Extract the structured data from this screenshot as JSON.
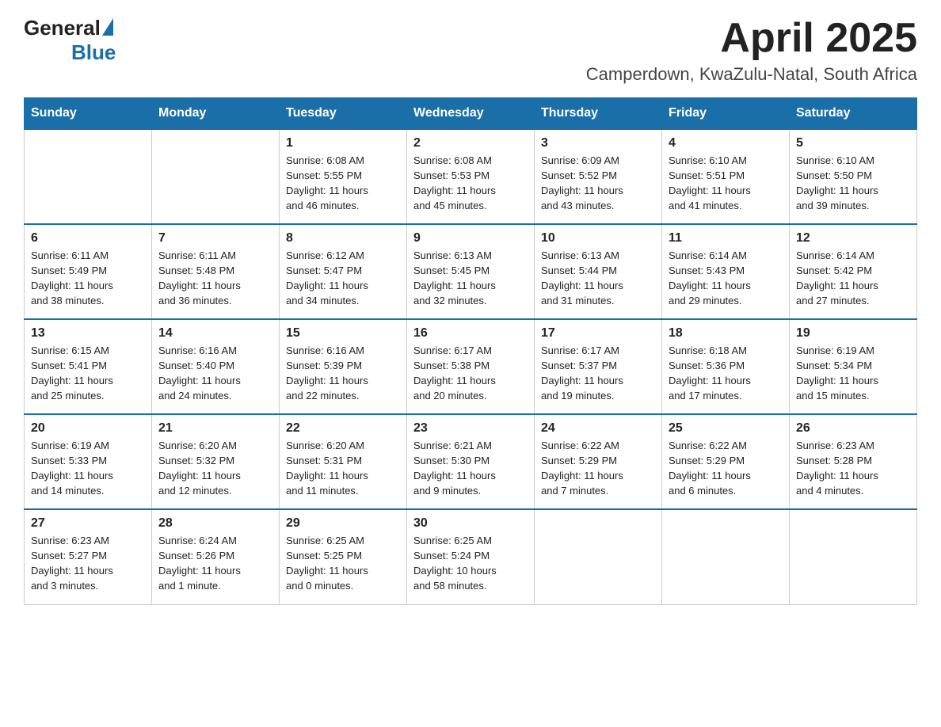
{
  "header": {
    "logo_general": "General",
    "logo_blue": "Blue",
    "month_title": "April 2025",
    "location": "Camperdown, KwaZulu-Natal, South Africa"
  },
  "weekdays": [
    "Sunday",
    "Monday",
    "Tuesday",
    "Wednesday",
    "Thursday",
    "Friday",
    "Saturday"
  ],
  "weeks": [
    [
      {
        "day": "",
        "info": ""
      },
      {
        "day": "",
        "info": ""
      },
      {
        "day": "1",
        "info": "Sunrise: 6:08 AM\nSunset: 5:55 PM\nDaylight: 11 hours\nand 46 minutes."
      },
      {
        "day": "2",
        "info": "Sunrise: 6:08 AM\nSunset: 5:53 PM\nDaylight: 11 hours\nand 45 minutes."
      },
      {
        "day": "3",
        "info": "Sunrise: 6:09 AM\nSunset: 5:52 PM\nDaylight: 11 hours\nand 43 minutes."
      },
      {
        "day": "4",
        "info": "Sunrise: 6:10 AM\nSunset: 5:51 PM\nDaylight: 11 hours\nand 41 minutes."
      },
      {
        "day": "5",
        "info": "Sunrise: 6:10 AM\nSunset: 5:50 PM\nDaylight: 11 hours\nand 39 minutes."
      }
    ],
    [
      {
        "day": "6",
        "info": "Sunrise: 6:11 AM\nSunset: 5:49 PM\nDaylight: 11 hours\nand 38 minutes."
      },
      {
        "day": "7",
        "info": "Sunrise: 6:11 AM\nSunset: 5:48 PM\nDaylight: 11 hours\nand 36 minutes."
      },
      {
        "day": "8",
        "info": "Sunrise: 6:12 AM\nSunset: 5:47 PM\nDaylight: 11 hours\nand 34 minutes."
      },
      {
        "day": "9",
        "info": "Sunrise: 6:13 AM\nSunset: 5:45 PM\nDaylight: 11 hours\nand 32 minutes."
      },
      {
        "day": "10",
        "info": "Sunrise: 6:13 AM\nSunset: 5:44 PM\nDaylight: 11 hours\nand 31 minutes."
      },
      {
        "day": "11",
        "info": "Sunrise: 6:14 AM\nSunset: 5:43 PM\nDaylight: 11 hours\nand 29 minutes."
      },
      {
        "day": "12",
        "info": "Sunrise: 6:14 AM\nSunset: 5:42 PM\nDaylight: 11 hours\nand 27 minutes."
      }
    ],
    [
      {
        "day": "13",
        "info": "Sunrise: 6:15 AM\nSunset: 5:41 PM\nDaylight: 11 hours\nand 25 minutes."
      },
      {
        "day": "14",
        "info": "Sunrise: 6:16 AM\nSunset: 5:40 PM\nDaylight: 11 hours\nand 24 minutes."
      },
      {
        "day": "15",
        "info": "Sunrise: 6:16 AM\nSunset: 5:39 PM\nDaylight: 11 hours\nand 22 minutes."
      },
      {
        "day": "16",
        "info": "Sunrise: 6:17 AM\nSunset: 5:38 PM\nDaylight: 11 hours\nand 20 minutes."
      },
      {
        "day": "17",
        "info": "Sunrise: 6:17 AM\nSunset: 5:37 PM\nDaylight: 11 hours\nand 19 minutes."
      },
      {
        "day": "18",
        "info": "Sunrise: 6:18 AM\nSunset: 5:36 PM\nDaylight: 11 hours\nand 17 minutes."
      },
      {
        "day": "19",
        "info": "Sunrise: 6:19 AM\nSunset: 5:34 PM\nDaylight: 11 hours\nand 15 minutes."
      }
    ],
    [
      {
        "day": "20",
        "info": "Sunrise: 6:19 AM\nSunset: 5:33 PM\nDaylight: 11 hours\nand 14 minutes."
      },
      {
        "day": "21",
        "info": "Sunrise: 6:20 AM\nSunset: 5:32 PM\nDaylight: 11 hours\nand 12 minutes."
      },
      {
        "day": "22",
        "info": "Sunrise: 6:20 AM\nSunset: 5:31 PM\nDaylight: 11 hours\nand 11 minutes."
      },
      {
        "day": "23",
        "info": "Sunrise: 6:21 AM\nSunset: 5:30 PM\nDaylight: 11 hours\nand 9 minutes."
      },
      {
        "day": "24",
        "info": "Sunrise: 6:22 AM\nSunset: 5:29 PM\nDaylight: 11 hours\nand 7 minutes."
      },
      {
        "day": "25",
        "info": "Sunrise: 6:22 AM\nSunset: 5:29 PM\nDaylight: 11 hours\nand 6 minutes."
      },
      {
        "day": "26",
        "info": "Sunrise: 6:23 AM\nSunset: 5:28 PM\nDaylight: 11 hours\nand 4 minutes."
      }
    ],
    [
      {
        "day": "27",
        "info": "Sunrise: 6:23 AM\nSunset: 5:27 PM\nDaylight: 11 hours\nand 3 minutes."
      },
      {
        "day": "28",
        "info": "Sunrise: 6:24 AM\nSunset: 5:26 PM\nDaylight: 11 hours\nand 1 minute."
      },
      {
        "day": "29",
        "info": "Sunrise: 6:25 AM\nSunset: 5:25 PM\nDaylight: 11 hours\nand 0 minutes."
      },
      {
        "day": "30",
        "info": "Sunrise: 6:25 AM\nSunset: 5:24 PM\nDaylight: 10 hours\nand 58 minutes."
      },
      {
        "day": "",
        "info": ""
      },
      {
        "day": "",
        "info": ""
      },
      {
        "day": "",
        "info": ""
      }
    ]
  ]
}
